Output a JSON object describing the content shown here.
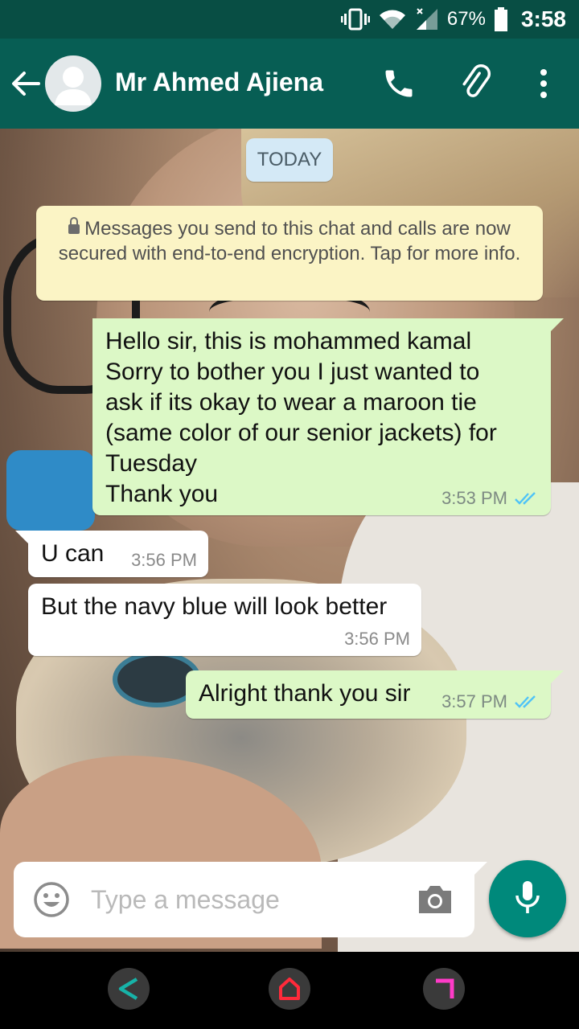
{
  "status_bar": {
    "battery_percent": "67%",
    "time": "3:58"
  },
  "header": {
    "contact_name": "Mr Ahmed Ajiena"
  },
  "chat": {
    "date_chip": "TODAY",
    "encryption_notice": "Messages you send to this chat and calls are now secured with end-to-end encryption. Tap for more info.",
    "messages": [
      {
        "direction": "outgoing",
        "text": "Hello sir, this is mohammed kamal\nSorry to bother you I just wanted to\nask if its okay to wear a maroon tie\n(same color of our senior jackets) for\nTuesday\nThank you",
        "time": "3:53 PM",
        "status": "read"
      },
      {
        "direction": "incoming",
        "text": "U can",
        "time": "3:56 PM"
      },
      {
        "direction": "incoming",
        "text": "But the navy blue will look better",
        "time": "3:56 PM"
      },
      {
        "direction": "outgoing",
        "text": "Alright thank you sir",
        "time": "3:57 PM",
        "status": "read"
      }
    ]
  },
  "composer": {
    "placeholder": "Type a message"
  },
  "colors": {
    "header": "#075e54",
    "status_bar": "#084e44",
    "outgoing_bubble": "#dcf8c6",
    "incoming_bubble": "#ffffff",
    "read_ticks": "#4fc3f7",
    "mic_button": "#00897b"
  },
  "icons": {
    "header": [
      "back-arrow-icon",
      "avatar-placeholder-icon",
      "phone-icon",
      "paperclip-icon",
      "more-vertical-icon"
    ],
    "status_bar": [
      "vibrate-icon",
      "wifi-icon",
      "signal-icon",
      "battery-icon"
    ],
    "composer": [
      "emoji-icon",
      "camera-icon",
      "microphone-icon"
    ],
    "navigation": [
      "nav-back-icon",
      "nav-home-icon",
      "nav-recents-icon"
    ]
  }
}
